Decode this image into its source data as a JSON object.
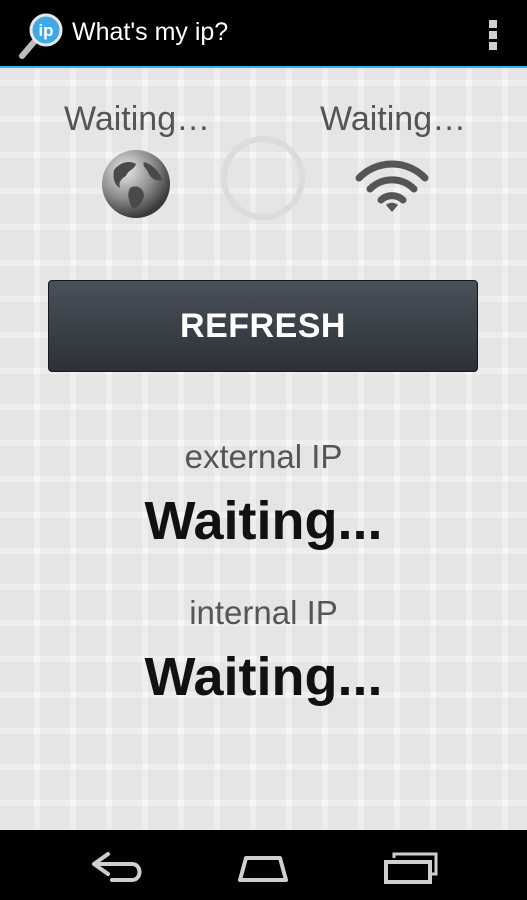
{
  "app": {
    "title": "What's my ip?",
    "icon": "ip-magnifier-icon"
  },
  "actionbar": {
    "overflow_icon": "overflow-menu-icon"
  },
  "status": {
    "external": "Waiting…",
    "wifi": "Waiting…",
    "globe_icon": "globe-icon",
    "loading_icon": "loading-spinner-icon",
    "wifi_icon": "wifi-icon"
  },
  "refresh_button": {
    "label": "REFRESH"
  },
  "external_ip": {
    "label": "external IP",
    "value": "Waiting..."
  },
  "internal_ip": {
    "label": "internal IP",
    "value": "Waiting..."
  },
  "navbar": {
    "back_icon": "back-icon",
    "home_icon": "home-icon",
    "recents_icon": "recent-apps-icon"
  },
  "colors": {
    "accent": "#33b5e5",
    "button": "#3a4048",
    "background": "#f6f6f6"
  }
}
